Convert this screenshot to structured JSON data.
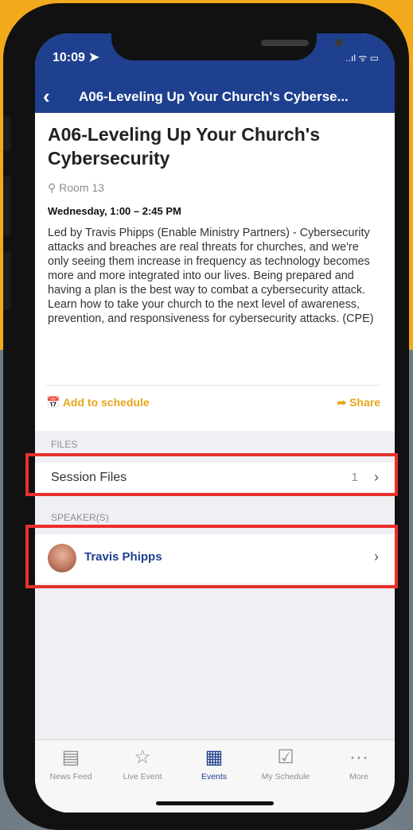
{
  "status_bar": {
    "time": "10:09 ➤",
    "icons": "..ıl ᯤ ▭"
  },
  "nav": {
    "back_icon": "‹",
    "title": "A06-Leveling Up Your Church's Cyberse..."
  },
  "session": {
    "title": "A06-Leveling Up Your Church's Cybersecurity",
    "room": "Room 13",
    "when": "Wednesday, 1:00 – 2:45 PM",
    "description": "Led by Travis Phipps (Enable Ministry Partners) - Cybersecurity attacks and breaches are real threats for churches, and we're only seeing them increase in frequency as technology becomes more and more integrated into our lives. Being prepared and having a plan is the best way to combat a cybersecurity attack. Learn how to take your church to the next level of awareness, prevention, and responsiveness for cybersecurity attacks. (CPE)"
  },
  "actions": {
    "add_label": "Add to schedule",
    "share_label": "Share"
  },
  "files": {
    "section_label": "FILES",
    "row_label": "Session Files",
    "count": "1"
  },
  "speakers": {
    "section_label": "SPEAKER(S)",
    "items": [
      {
        "name": "Travis Phipps"
      }
    ]
  },
  "tabs": [
    {
      "label": "News Feed",
      "icon": "newspaper-icon"
    },
    {
      "label": "Live Event",
      "icon": "star-calendar-icon"
    },
    {
      "label": "Events",
      "icon": "calendar-grid-icon",
      "active": true
    },
    {
      "label": "My Schedule",
      "icon": "calendar-check-icon"
    },
    {
      "label": "More",
      "icon": "more-dots-icon"
    }
  ],
  "colors": {
    "brand": "#1f3f8f",
    "accent": "#e7a51a",
    "highlight": "#e8302c",
    "background": "#f2aa1c"
  }
}
